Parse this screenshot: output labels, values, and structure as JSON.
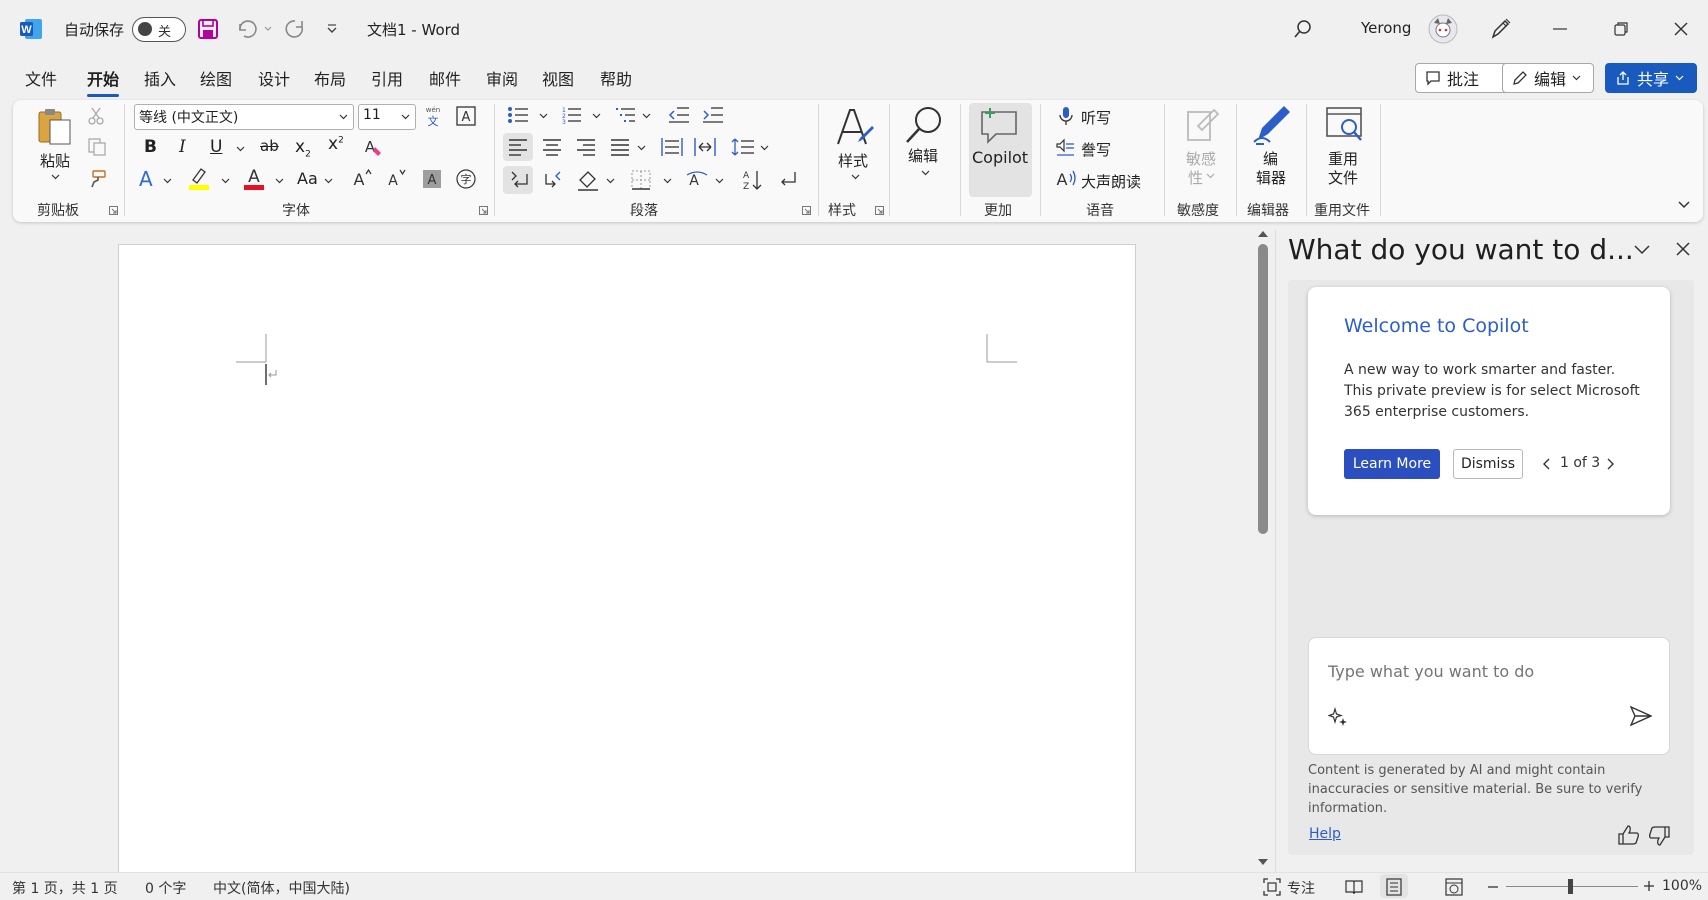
{
  "titlebar": {
    "autosave_label": "自动保存",
    "autosave_state": "关",
    "doc_title": "文档1  -  Word",
    "user_name": "Yerong"
  },
  "tabs": [
    "文件",
    "开始",
    "插入",
    "绘图",
    "设计",
    "布局",
    "引用",
    "邮件",
    "审阅",
    "视图",
    "帮助"
  ],
  "active_tab": "开始",
  "header_buttons": {
    "comments": "批注",
    "editing": "编辑",
    "share": "共享"
  },
  "ribbon": {
    "clipboard": {
      "paste": "粘贴",
      "group": "剪贴板"
    },
    "font": {
      "name": "等线 (中文正文)",
      "size": "11",
      "case": "Aa",
      "group": "字体"
    },
    "paragraph": {
      "group": "段落"
    },
    "styles": {
      "label": "样式",
      "group": "样式"
    },
    "editing": {
      "label": "编辑"
    },
    "more": {
      "copilot": "Copilot",
      "group": "更加"
    },
    "voice": {
      "dictate": "听写",
      "transcribe": "誊写",
      "read_aloud": "大声朗读",
      "group": "语音"
    },
    "sensitivity": {
      "label_line1": "敏感",
      "label_line2": "性",
      "group": "敏感度"
    },
    "editor": {
      "label_line1": "编",
      "label_line2": "辑器",
      "group": "编辑器"
    },
    "reuse": {
      "label_line1": "重用",
      "label_line2": "文件",
      "group": "重用文件"
    }
  },
  "copilot": {
    "pane_title": "What do you want to d...",
    "card_title": "Welcome to Copilot",
    "card_body": "A new way to work smarter and faster. This private preview is for select Microsoft 365 enterprise customers.",
    "learn_more": "Learn More",
    "dismiss": "Dismiss",
    "pager": "1 of 3",
    "input_placeholder": "Type what you want to do",
    "disclaimer": "Content is generated by AI and might contain inaccuracies or sensitive material. Be sure to verify information.",
    "help": "Help"
  },
  "statusbar": {
    "page": "第 1 页，共 1 页",
    "words": "0 个字",
    "language": "中文(简体，中国大陆)",
    "focus": "专注",
    "zoom": "100%"
  },
  "colors": {
    "accent": "#185abd",
    "copilot_blue": "#2b5ec9",
    "save_icon": "#b4009e"
  }
}
